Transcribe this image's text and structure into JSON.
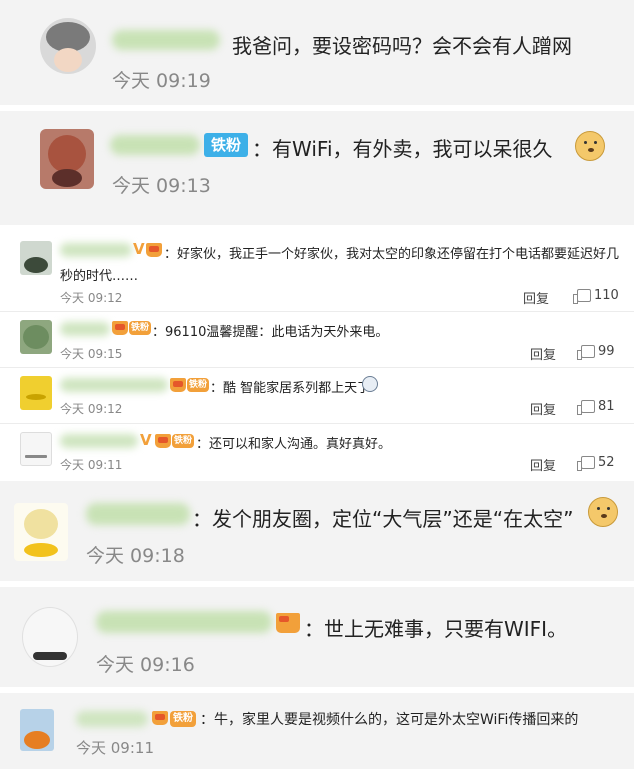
{
  "comments": [
    {
      "text": "我爸问，要设密码吗？会不会有人蹭网",
      "time": "今天 09:19"
    },
    {
      "badge": "铁粉",
      "text": "：有WiFi，有外卖，我可以呆很久",
      "time": "今天 09:13"
    },
    {
      "text": "：好家伙，我正手一个好家伙，我对太空的印象还停留在打个电话都要延迟好几",
      "text2": "秒的时代……",
      "time": "今天 09:12",
      "reply": "回复",
      "likes": "110"
    },
    {
      "badge": "铁粉",
      "text": "：96110温馨提醒：此电话为天外来电。",
      "time": "今天 09:15",
      "reply": "回复",
      "likes": "99"
    },
    {
      "badge": "铁粉",
      "text": "：酷 智能家居系列都上天了",
      "time": "今天 09:12",
      "reply": "回复",
      "likes": "81"
    },
    {
      "badge": "铁粉",
      "text": "：还可以和家人沟通。真好真好。",
      "time": "今天 09:11",
      "reply": "回复",
      "likes": "52"
    },
    {
      "text": "：发个朋友圈，定位“大气层”还是“在太空”",
      "time": "今天 09:18"
    },
    {
      "text": "：世上无难事，只要有WIFI。",
      "time": "今天 09:16"
    },
    {
      "badge": "铁粉",
      "text": "：牛，家里人要是视频什么的，这可是外太空WiFi传播回来的",
      "time": "今天 09:11"
    }
  ]
}
